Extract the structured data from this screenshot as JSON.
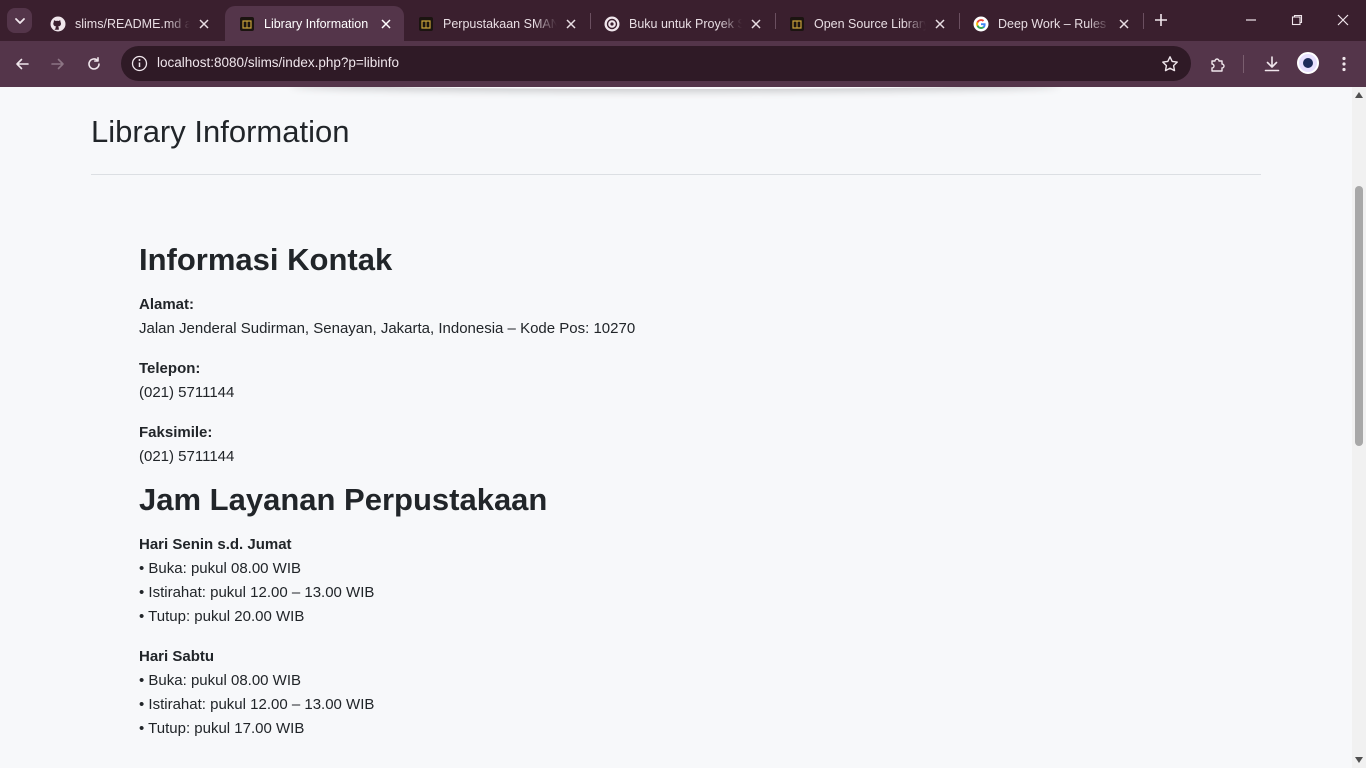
{
  "browser": {
    "tabs": [
      {
        "title": "slims/README.md at",
        "favicon": "github-icon"
      },
      {
        "title": "Library Information",
        "favicon": "slims-logo-icon",
        "active": true
      },
      {
        "title": "Perpustakaan SMAN",
        "favicon": "slims-logo-icon"
      },
      {
        "title": "Buku untuk Proyek SL",
        "favicon": "chatgpt-icon"
      },
      {
        "title": "Open Source Library",
        "favicon": "slims-logo-icon"
      },
      {
        "title": "Deep Work – Rules fo",
        "favicon": "google-icon"
      }
    ],
    "url": "localhost:8080/slims/index.php?p=libinfo",
    "colors": {
      "frame": "#3a1f2e",
      "toolbar": "#54354a",
      "omnibox": "#2f1a26"
    }
  },
  "page": {
    "title": "Library Information",
    "contact": {
      "heading": "Informasi Kontak",
      "address_label": "Alamat:",
      "address_value": "Jalan Jenderal Sudirman, Senayan, Jakarta, Indonesia – Kode Pos: 10270",
      "phone_label": "Telepon:",
      "phone_value": "(021) 5711144",
      "fax_label": "Faksimile:",
      "fax_value": "(021) 5711144"
    },
    "hours": {
      "heading": "Jam Layanan Perpustakaan",
      "weekday": {
        "label": "Hari Senin s.d. Jumat",
        "items": [
          "• Buka: pukul 08.00 WIB",
          "• Istirahat: pukul 12.00 – 13.00 WIB",
          "• Tutup: pukul 20.00 WIB"
        ]
      },
      "saturday": {
        "label": "Hari Sabtu",
        "items": [
          "• Buka: pukul 08.00 WIB",
          "• Istirahat: pukul 12.00 – 13.00 WIB",
          "• Tutup: pukul 17.00 WIB"
        ]
      }
    }
  }
}
